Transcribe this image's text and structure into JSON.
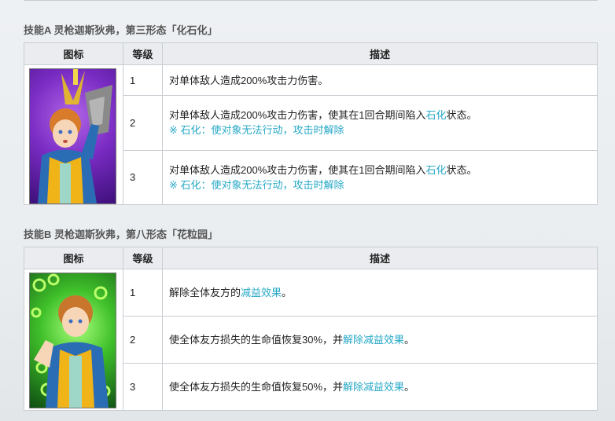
{
  "skillA": {
    "title": "技能A 灵枪迦斯狄弗，第三形态「化石化」",
    "headers": {
      "icon": "图标",
      "level": "等级",
      "desc": "描述"
    },
    "rows": [
      {
        "level": "1",
        "desc_pre": "对单体敌人造成200%攻击力伤害。"
      },
      {
        "level": "2",
        "desc_pre": "对单体敌人造成200%攻击力伤害，使其在1回合期间陷入",
        "link": "石化",
        "desc_post": "状态。",
        "note": "※ 石化：使对象无法行动，攻击时解除"
      },
      {
        "level": "3",
        "desc_pre": "对单体敌人造成200%攻击力伤害，使其在1回合期间陷入",
        "link": "石化",
        "desc_post": "状态。",
        "note": "※ 石化：使对象无法行动，攻击时解除"
      }
    ]
  },
  "skillB": {
    "title": "技能B 灵枪迦斯狄弗，第八形态「花粒园」",
    "headers": {
      "icon": "图标",
      "level": "等级",
      "desc": "描述"
    },
    "rows": [
      {
        "level": "1",
        "desc_pre": "解除全体友方的",
        "link": "减益效果",
        "desc_post": "。"
      },
      {
        "level": "2",
        "desc_pre": "使全体友方损失的生命值恢复30%，并",
        "link": "解除减益效果",
        "desc_post": "。"
      },
      {
        "level": "3",
        "desc_pre": "使全体友方损失的生命值恢复50%，并",
        "link": "解除减益效果",
        "desc_post": "。"
      }
    ]
  },
  "colors": {
    "link": "#27a9c6",
    "header_bg": "#eaecf0",
    "border": "#c9ced3"
  }
}
